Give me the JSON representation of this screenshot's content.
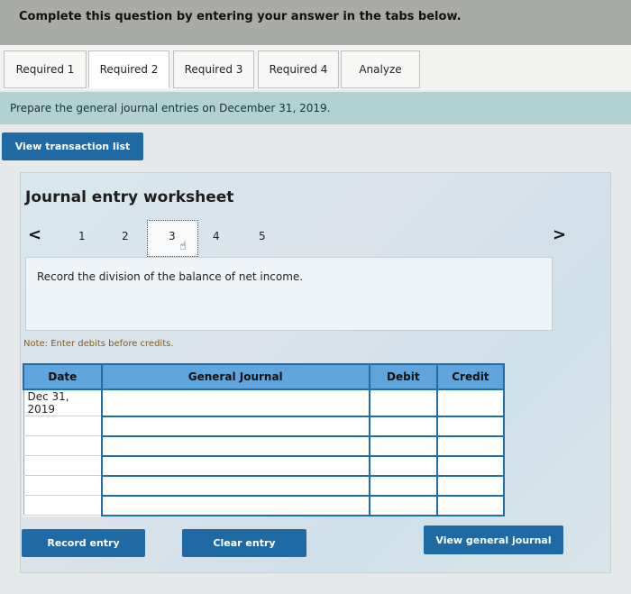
{
  "banner": {
    "text": "Complete this question by entering your answer in the tabs below."
  },
  "tabs": [
    {
      "label": "Required 1"
    },
    {
      "label": "Required 2"
    },
    {
      "label": "Required 3"
    },
    {
      "label": "Required 4"
    },
    {
      "label": "Analyze"
    }
  ],
  "instruction": "Prepare the general journal entries on December 31, 2019.",
  "buttons": {
    "view_transactions": "View transaction list",
    "record_entry": "Record entry",
    "clear_entry": "Clear entry",
    "view_general_journal": "View general journal"
  },
  "worksheet": {
    "title": "Journal entry worksheet",
    "pages": [
      "1",
      "2",
      "3",
      "4",
      "5"
    ],
    "current_page": "3",
    "prev_icon": "<",
    "next_icon": ">",
    "record_text": "Record the division of the balance of net income.",
    "note": "Note: Enter debits before credits."
  },
  "table": {
    "headers": {
      "date": "Date",
      "journal": "General Journal",
      "debit": "Debit",
      "credit": "Credit"
    },
    "rows": [
      {
        "date": "Dec 31, 2019",
        "journal": "",
        "debit": "",
        "credit": ""
      },
      {
        "date": "",
        "journal": "",
        "debit": "",
        "credit": ""
      },
      {
        "date": "",
        "journal": "",
        "debit": "",
        "credit": ""
      },
      {
        "date": "",
        "journal": "",
        "debit": "",
        "credit": ""
      },
      {
        "date": "",
        "journal": "",
        "debit": "",
        "credit": ""
      },
      {
        "date": "",
        "journal": "",
        "debit": "",
        "credit": ""
      }
    ]
  },
  "colors": {
    "accent_button": "#1f6aa5",
    "table_header": "#5fa4dc",
    "table_border": "#1e6eae"
  }
}
